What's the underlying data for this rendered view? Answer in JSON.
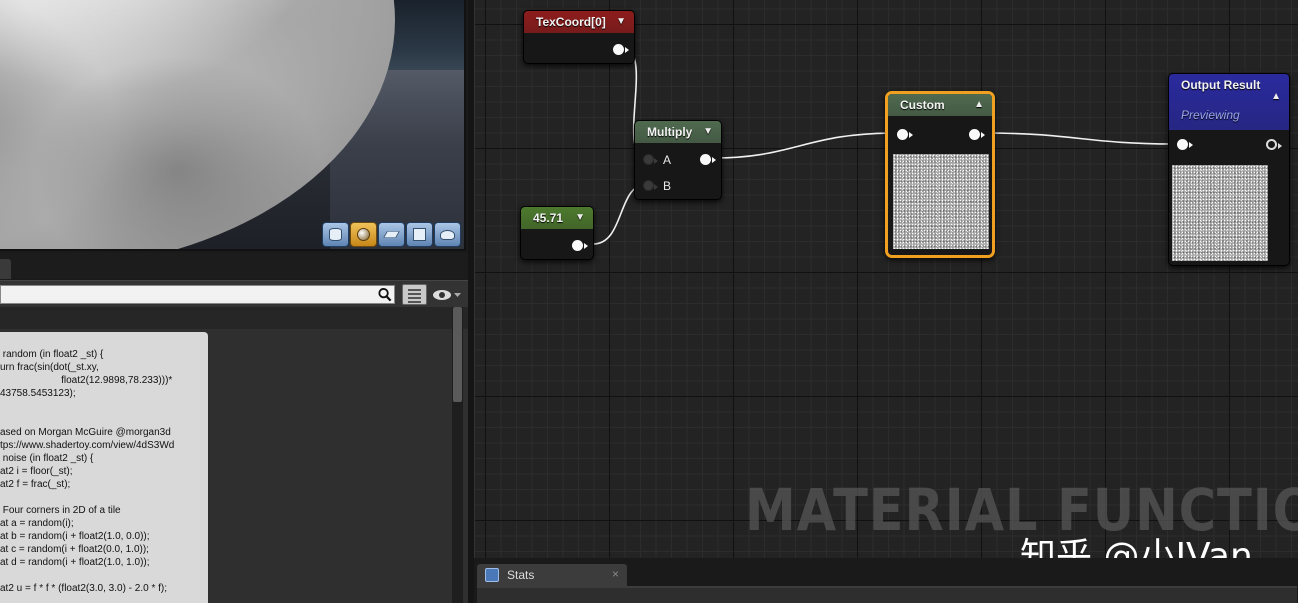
{
  "preview_toolbar": {
    "buttons": [
      "cylinder-icon",
      "sphere-icon",
      "plane-icon",
      "cube-icon",
      "teapot-icon"
    ],
    "active": "sphere-icon"
  },
  "details": {
    "search_value": "",
    "code_lines": [
      " random (in float2 _st) {",
      "urn frac(sin(dot(_st.xy,",
      "                      float2(12.9898,78.233)))*",
      "43758.5453123);",
      "",
      "",
      "ased on Morgan McGuire @morgan3d",
      "tps://www.shadertoy.com/view/4dS3Wd",
      " noise (in float2 _st) {",
      "at2 i = floor(_st);",
      "at2 f = frac(_st);",
      "",
      " Four corners in 2D of a tile",
      "at a = random(i);",
      "at b = random(i + float2(1.0, 0.0));",
      "at c = random(i + float2(0.0, 1.0));",
      "at d = random(i + float2(1.0, 1.0));",
      "",
      "at2 u = f * f * (float2(3.0, 3.0) - 2.0 * f);"
    ]
  },
  "graph": {
    "nodes": {
      "texcoord": {
        "title": "TexCoord[0]",
        "color": "#8e1c1c"
      },
      "multiply": {
        "title": "Multiply",
        "color": "#4f6a4f",
        "pin_a": "A",
        "pin_b": "B"
      },
      "constant": {
        "title": "45.71",
        "color": "#4d7a2e"
      },
      "custom": {
        "title": "Custom",
        "color": "#4f6a4f",
        "selection_color": "#f0a020"
      },
      "output": {
        "title": "Output Result",
        "subtitle": "Previewing",
        "color": "#2a2a9e"
      }
    },
    "watermark": "MATERIAL FUNCTION"
  },
  "overlay_tag": "知乎 @小IVan",
  "stats_tab": {
    "label": "Stats",
    "close": "×"
  }
}
